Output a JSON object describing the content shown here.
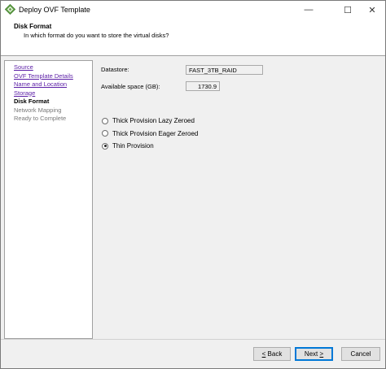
{
  "window": {
    "title": "Deploy OVF Template",
    "minimize_glyph": "—",
    "maximize_glyph": "☐",
    "close_glyph": "✕",
    "icon": "vsphere-app-icon",
    "icon_color": "#6aa84f"
  },
  "header": {
    "title": "Disk Format",
    "subtitle": "In which format do you want to store the virtual disks?"
  },
  "sidebar": {
    "items": [
      {
        "label": "Source",
        "state": "link"
      },
      {
        "label": "OVF Template Details",
        "state": "link"
      },
      {
        "label": "Name and Location",
        "state": "link"
      },
      {
        "label": "Storage",
        "state": "link"
      },
      {
        "label": "Disk Format",
        "state": "current"
      },
      {
        "label": "Network Mapping",
        "state": "pending"
      },
      {
        "label": "Ready to Complete",
        "state": "pending"
      }
    ]
  },
  "content": {
    "datastore_label": "Datastore:",
    "datastore_value": "FAST_3TB_RAID",
    "space_label": "Available space (GB):",
    "space_value": "1730.9",
    "options": [
      {
        "label": "Thick Provision Lazy Zeroed",
        "selected": false
      },
      {
        "label": "Thick Provision Eager Zeroed",
        "selected": false
      },
      {
        "label": "Thin Provision",
        "selected": true
      }
    ]
  },
  "footer": {
    "back_mnemonic": "<",
    "back_text": " Back",
    "next_text": "Next ",
    "next_mnemonic": ">",
    "cancel_label": "Cancel"
  }
}
